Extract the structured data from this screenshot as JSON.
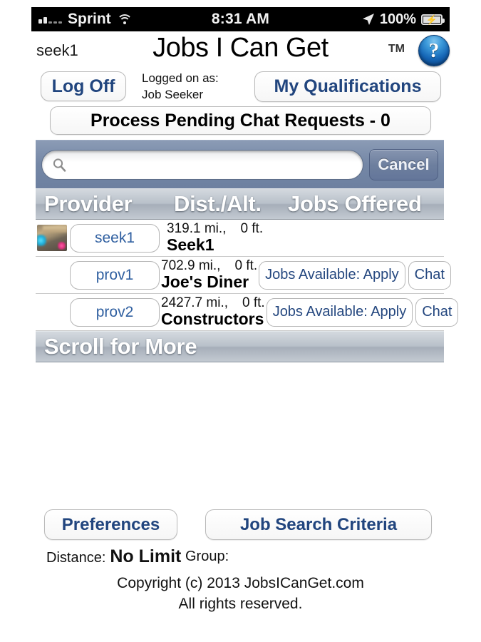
{
  "status_bar": {
    "carrier": "Sprint",
    "time": "8:31 AM",
    "battery_percent": "100%",
    "signal_icon": "signal-bars-icon",
    "wifi_icon": "wifi-icon",
    "location_icon": "location-arrow-icon",
    "battery_icon": "battery-charging-icon"
  },
  "header": {
    "username": "seek1",
    "app_title": "Jobs I Can Get",
    "trademark": "TM",
    "help_icon": "help-question-icon",
    "help_glyph": "?"
  },
  "actions": {
    "log_off_label": "Log Off",
    "logged_on_label": "Logged on as:",
    "logged_on_role": "Job Seeker",
    "my_qualifications_label": "My Qualifications",
    "chat_requests_label": "Process Pending Chat Requests - 0"
  },
  "search": {
    "value": "",
    "placeholder": "",
    "icon": "search-icon",
    "cancel_label": "Cancel"
  },
  "table": {
    "columns": [
      "Provider",
      "Dist./Alt.",
      "Jobs Offered"
    ],
    "rows": [
      {
        "provider_id": "seek1",
        "distance": "319.1 mi.,",
        "altitude": "0 ft.",
        "name": "Seek1",
        "jobs_label": "",
        "chat_label": "",
        "has_thumbnail": true,
        "has_jobs": false
      },
      {
        "provider_id": "prov1",
        "distance": "702.9 mi.,",
        "altitude": "0 ft.",
        "name": "Joe's Diner",
        "jobs_label": "Jobs Available: Apply",
        "chat_label": "Chat",
        "has_thumbnail": false,
        "has_jobs": true
      },
      {
        "provider_id": "prov2",
        "distance": "2427.7 mi.,",
        "altitude": "0 ft.",
        "name": "Constructors",
        "jobs_label": "Jobs Available: Apply",
        "chat_label": "Chat",
        "has_thumbnail": false,
        "has_jobs": true
      }
    ],
    "scroll_more_label": "Scroll for More"
  },
  "footer": {
    "preferences_label": "Preferences",
    "job_search_criteria_label": "Job Search Criteria",
    "distance_label": "Distance:",
    "distance_value": "No Limit",
    "group_label": "Group:",
    "copyright_line1": "Copyright (c) 2013 JobsICanGet.com",
    "copyright_line2": "All rights reserved."
  },
  "colors": {
    "accent_blue": "#21457e",
    "search_bar_bg": "#74879f",
    "header_bar_bg": "#b8c0c9",
    "status_bar_bg": "#000000"
  }
}
